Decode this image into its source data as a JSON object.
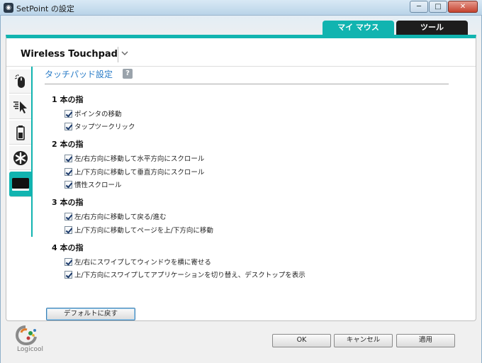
{
  "window": {
    "title": "SetPoint の設定",
    "minimize": "─",
    "maximize": "□",
    "close": "✕"
  },
  "tabs": {
    "mymouse": "マイ マウス",
    "tool": "ツール"
  },
  "device": {
    "name": "Wireless Touchpad"
  },
  "sidebar": {
    "items": [
      {
        "icon": "mouse-icon",
        "active": false
      },
      {
        "icon": "pointer-icon",
        "active": false
      },
      {
        "icon": "battery-icon",
        "active": false
      },
      {
        "icon": "asterisk-icon",
        "active": false
      },
      {
        "icon": "touchpad-icon",
        "active": true
      }
    ]
  },
  "content": {
    "title": "タッチパッド設定",
    "help": "?",
    "groups": [
      {
        "heading": "1 本の指",
        "options": [
          {
            "label": "ポインタの移動",
            "checked": true
          },
          {
            "label": "タップツークリック",
            "checked": true
          }
        ]
      },
      {
        "heading": "2 本の指",
        "options": [
          {
            "label": "左/右方向に移動して水平方向にスクロール",
            "checked": true
          },
          {
            "label": "上/下方向に移動して垂直方向にスクロール",
            "checked": true
          },
          {
            "label": "慣性スクロール",
            "checked": true
          }
        ]
      },
      {
        "heading": "3 本の指",
        "options": [
          {
            "label": "左/右方向に移動して戻る/進む",
            "checked": true
          },
          {
            "label": "上/下方向に移動してページを上/下方向に移動",
            "checked": true
          }
        ]
      },
      {
        "heading": "4 本の指",
        "options": [
          {
            "label": "左/右にスワイプしてウィンドウを横に寄せる",
            "checked": true
          },
          {
            "label": "上/下方向にスワイプしてアプリケーションを切り替え、デスクトップを表示",
            "checked": true
          }
        ]
      }
    ],
    "default_button": "デフォルトに戻す"
  },
  "footer": {
    "brand": "Logicool",
    "ok": "OK",
    "cancel": "キャンセル",
    "apply": "適用"
  },
  "colors": {
    "accent": "#11b4b0",
    "title_blue": "#2a7cc7"
  }
}
